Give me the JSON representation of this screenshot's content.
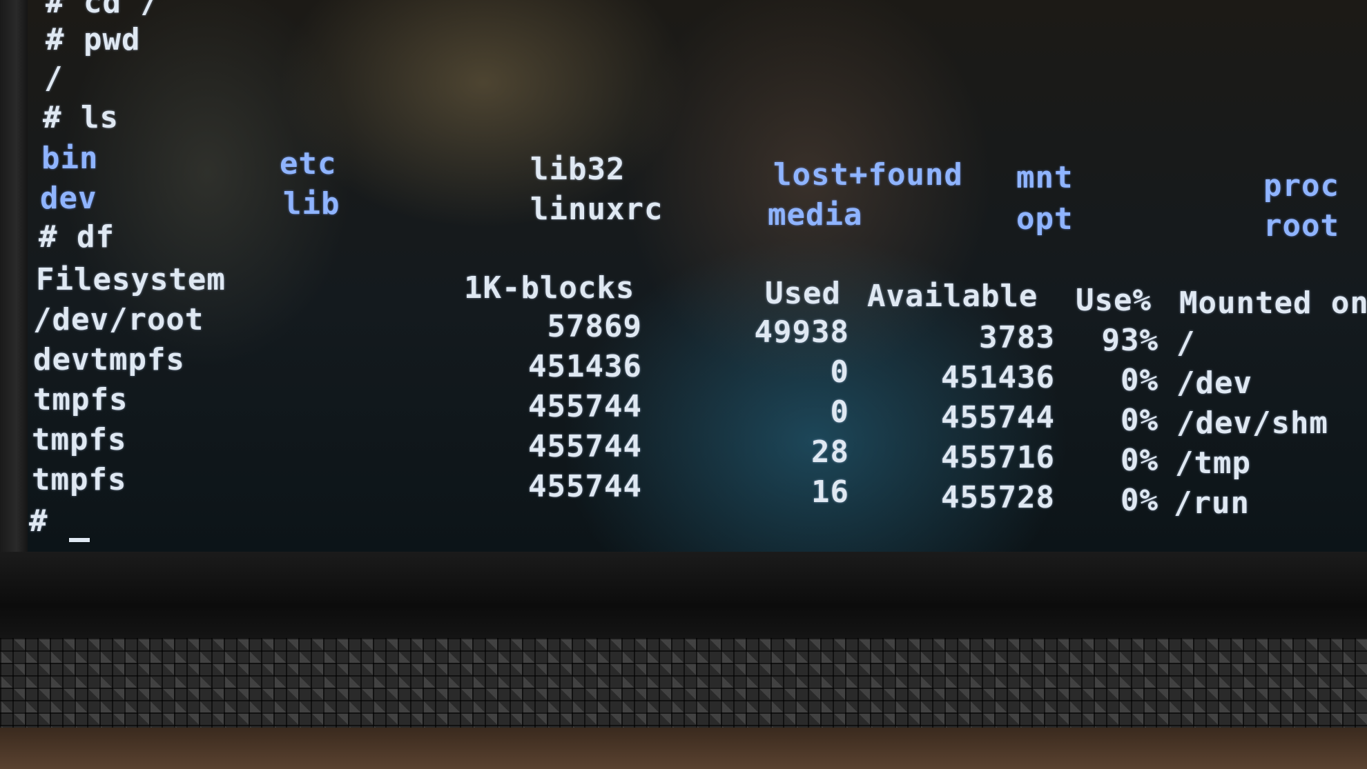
{
  "terminal": {
    "lines": {
      "cmd_cd": "# cd /",
      "cmd_pwd": "# pwd",
      "pwd_out": "/",
      "cmd_ls": "# ls",
      "cmd_df": "# df",
      "prompt": "#"
    },
    "ls_entries": {
      "bin": "bin",
      "etc": "etc",
      "lib32": "lib32",
      "lost_found": "lost+found",
      "mnt": "mnt",
      "proc": "proc",
      "dev": "dev",
      "lib": "lib",
      "linuxrc": "linuxrc",
      "media": "media",
      "opt": "opt",
      "root": "root"
    },
    "df": {
      "headers": {
        "filesystem": "Filesystem",
        "blocks": "1K-blocks",
        "used": "Used",
        "available": "Available",
        "use_pct": "Use%",
        "mounted": "Mounted on"
      },
      "rows": [
        {
          "fs": "/dev/root",
          "blocks": "57869",
          "used": "49938",
          "avail": "3783",
          "pct": "93%",
          "mount": "/"
        },
        {
          "fs": "devtmpfs",
          "blocks": "451436",
          "used": "0",
          "avail": "451436",
          "pct": "0%",
          "mount": "/dev"
        },
        {
          "fs": "tmpfs",
          "blocks": "455744",
          "used": "0",
          "avail": "455744",
          "pct": "0%",
          "mount": "/dev/shm"
        },
        {
          "fs": "tmpfs",
          "blocks": "455744",
          "used": "28",
          "avail": "455716",
          "pct": "0%",
          "mount": "/tmp"
        },
        {
          "fs": "tmpfs",
          "blocks": "455744",
          "used": "16",
          "avail": "455728",
          "pct": "0%",
          "mount": "/run"
        }
      ]
    }
  }
}
